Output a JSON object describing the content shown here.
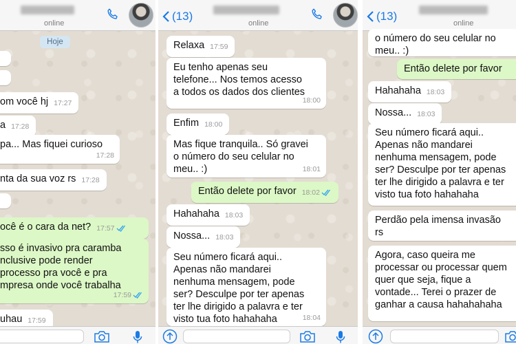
{
  "panels": [
    {
      "status": "online",
      "date_label": "Hoje",
      "messages": [
        {
          "text": "om você hj",
          "time": "17:27"
        },
        {
          "text": "a",
          "time": "17:28"
        },
        {
          "text": "pa... Mas fiquei curioso",
          "time": "17:28"
        },
        {
          "text": "nta da sua voz rs",
          "time": "17:28"
        },
        {
          "text": "ocê é o cara da net?",
          "time": "17:57"
        },
        {
          "text": "sso é invasivo pra caramba\nnclusive pode render\nprocesso pra você e pra\nmpresa onde você trabalha",
          "time": "17:59"
        },
        {
          "text": "uhau",
          "time": "17:59"
        }
      ]
    },
    {
      "back_count": "(13)",
      "status": "online",
      "messages": [
        {
          "text": "Relaxa",
          "time": "17:59"
        },
        {
          "text": "Eu tenho apenas seu\ntelefone... Nos temos acesso\na todos os dados dos clientes",
          "time": "18:00"
        },
        {
          "text": "Enfim",
          "time": "18:00"
        },
        {
          "text": "Mas fique tranquila.. Só gravei\no número do seu celular no\nmeu..  :)",
          "time": "18:01"
        },
        {
          "text": "Então delete por favor",
          "time": "18:02"
        },
        {
          "text": "Hahahaha",
          "time": "18:03"
        },
        {
          "text": "Nossa...",
          "time": "18:03"
        },
        {
          "text": "Seu número ficará aqui..\nApenas não mandarei\nnenhuma mensagem, pode\nser? Desculpe por ter apenas\nter lhe dirigido a palavra e ter\nvisto tua foto hahahaha",
          "time": "18:04"
        }
      ]
    },
    {
      "back_count": "(13)",
      "status": "online",
      "messages": [
        {
          "text": "o número do seu celular no\nmeu..  :)",
          "time": ""
        },
        {
          "text": "Então delete por favor",
          "time": ""
        },
        {
          "text": "Hahahaha",
          "time": "18:03"
        },
        {
          "text": "Nossa...",
          "time": "18:03"
        },
        {
          "text": "Seu número ficará aqui..\nApenas não mandarei\nnenhuma mensagem, pode\nser? Desculpe por ter apenas\nter lhe dirigido a palavra e ter\nvisto tua foto hahahaha",
          "time": ""
        },
        {
          "text": "Perdão pela imensa invasão\nrs",
          "time": ""
        },
        {
          "text": "Agora, caso queira me\nprocessar ou processar quem\nquer que seja, fique a\nvontade... Terei o prazer de\nganhar a causa hahahahaha",
          "time": ""
        }
      ]
    }
  ],
  "icons": {
    "back": "chevron-left-icon",
    "call": "phone-icon",
    "attach": "share-icon",
    "camera": "camera-icon",
    "mic": "microphone-icon",
    "read_ticks": "double-check-icon"
  },
  "colors": {
    "accent": "#1a7ae6",
    "incoming_bubble": "#ffffff",
    "outgoing_bubble": "#dcf8c6",
    "read_ticks": "#34a6f0",
    "chat_background": "#e3dcd2",
    "date_pill": "#d5e6f3"
  }
}
